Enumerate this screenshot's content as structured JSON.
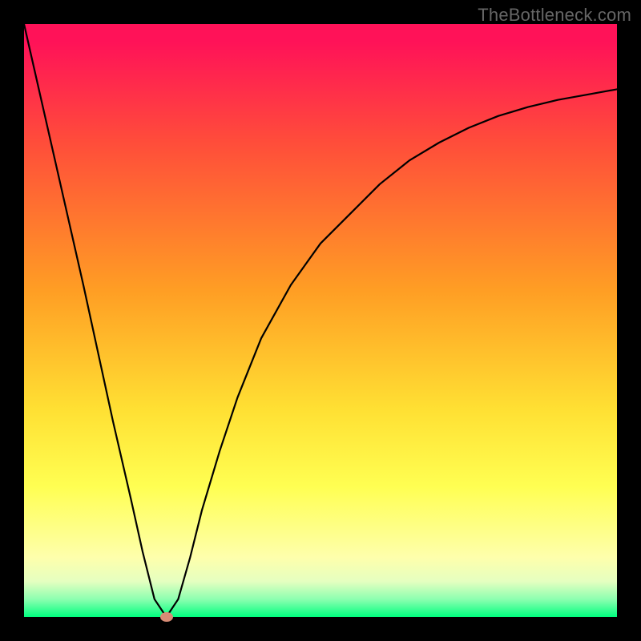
{
  "watermark": "TheBottleneck.com",
  "chart_data": {
    "type": "line",
    "title": "",
    "xlabel": "",
    "ylabel": "",
    "xlim": [
      0,
      100
    ],
    "ylim": [
      0,
      100
    ],
    "series": [
      {
        "name": "bottleneck-curve",
        "x": [
          0,
          5,
          10,
          15,
          18,
          20,
          22,
          24,
          26,
          28,
          30,
          33,
          36,
          40,
          45,
          50,
          55,
          60,
          65,
          70,
          75,
          80,
          85,
          90,
          95,
          100
        ],
        "y": [
          100,
          78,
          56,
          33,
          20,
          11,
          3,
          0,
          3,
          10,
          18,
          28,
          37,
          47,
          56,
          63,
          68,
          73,
          77,
          80,
          82.5,
          84.5,
          86,
          87.2,
          88.1,
          89
        ]
      }
    ],
    "marker": {
      "x": 24,
      "y": 0,
      "name": "optimal-point"
    },
    "gradient_stops": [
      {
        "pos": 0,
        "color": "#ff1258"
      },
      {
        "pos": 20,
        "color": "#ff4d3a"
      },
      {
        "pos": 45,
        "color": "#ff9e24"
      },
      {
        "pos": 65,
        "color": "#ffe033"
      },
      {
        "pos": 78,
        "color": "#ffff52"
      },
      {
        "pos": 94,
        "color": "#e5ffc0"
      },
      {
        "pos": 100,
        "color": "#00ff7f"
      }
    ]
  }
}
